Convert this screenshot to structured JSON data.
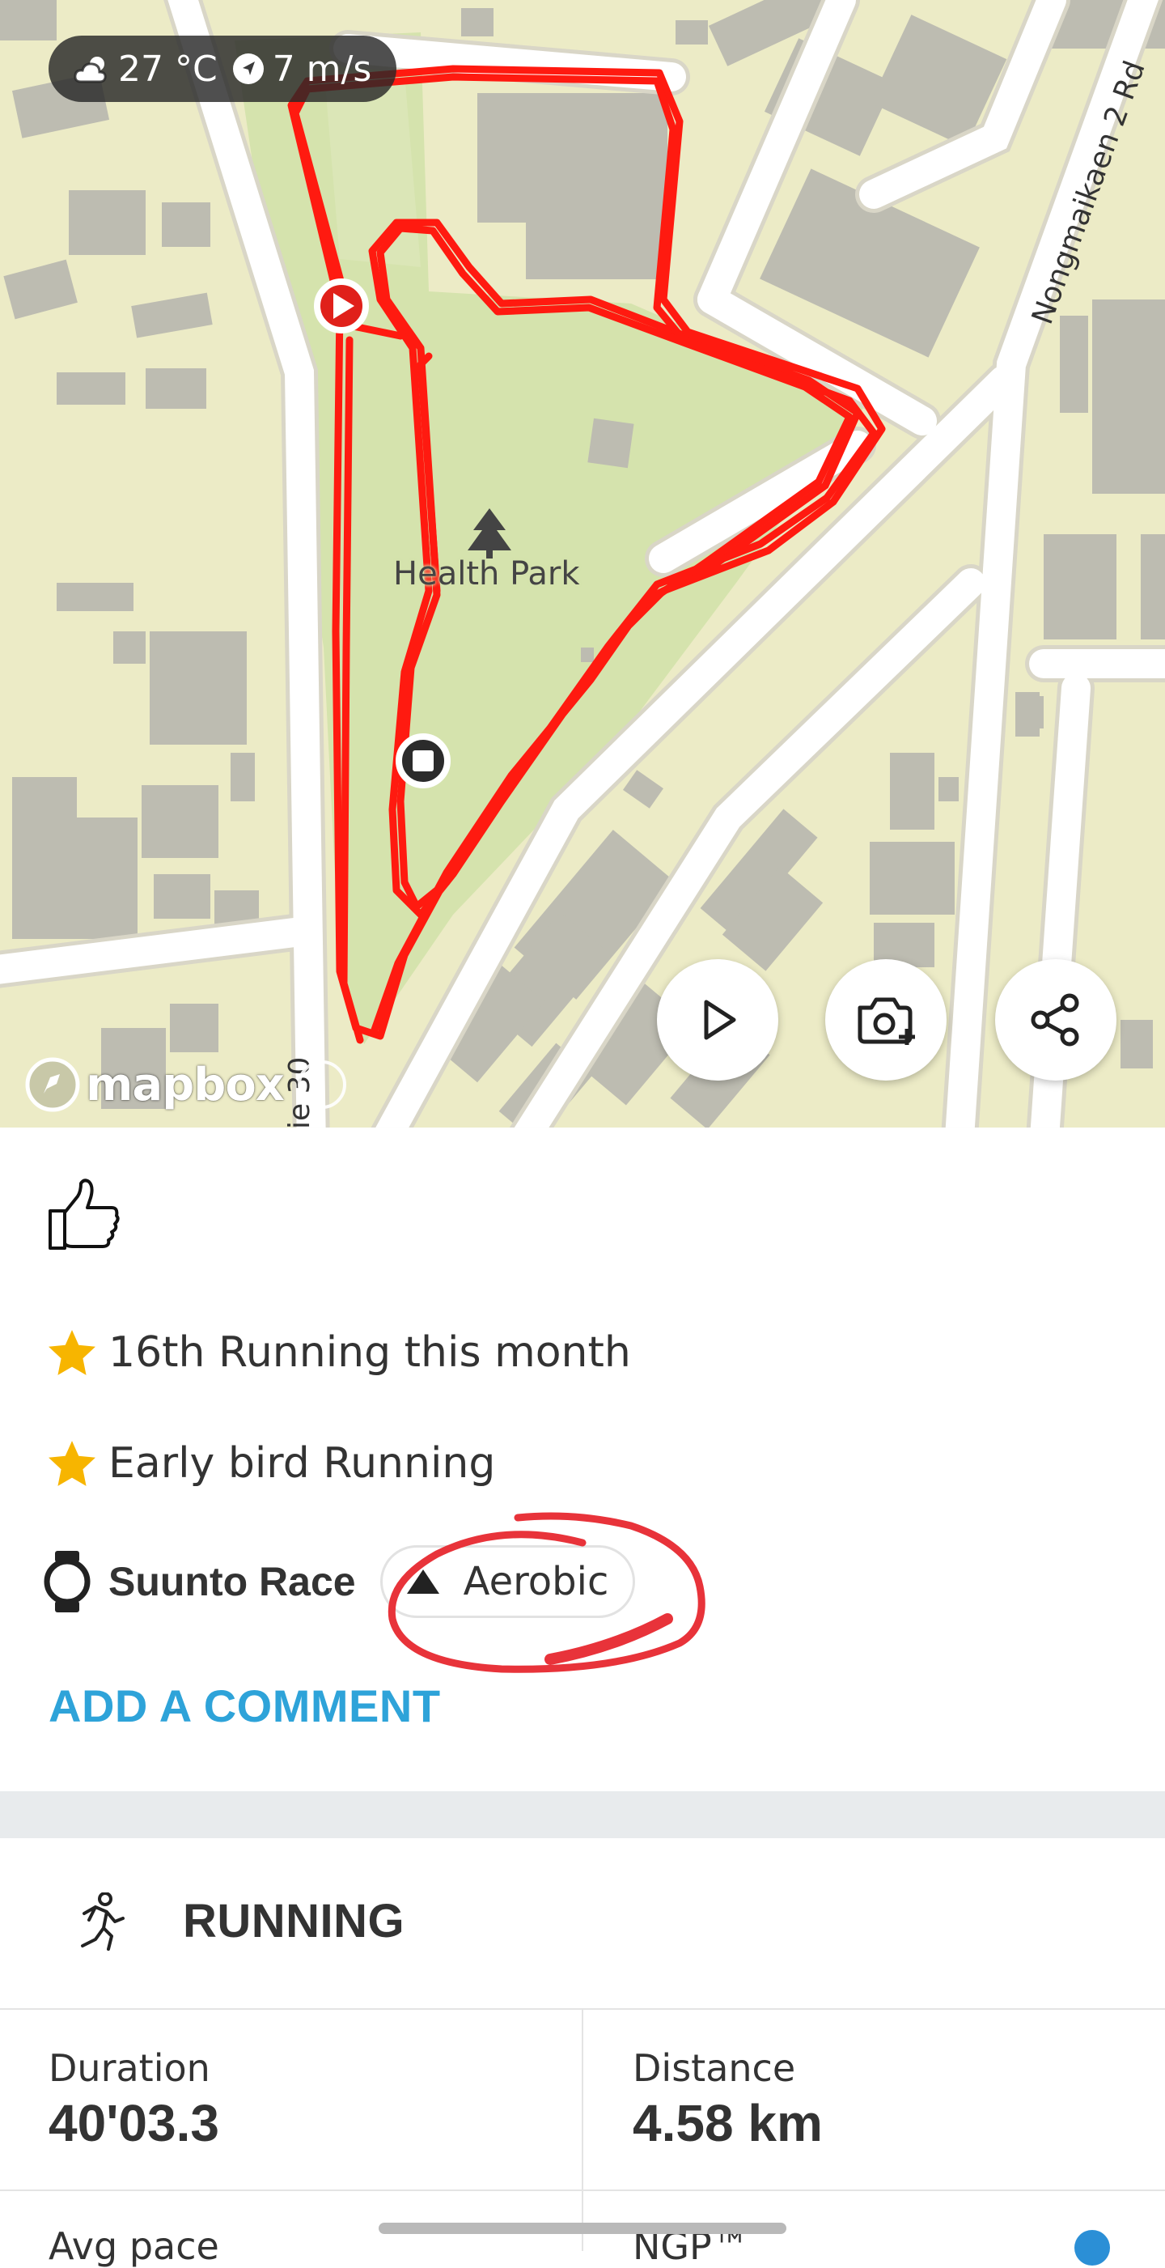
{
  "map": {
    "weather": {
      "temperature": "27 °C",
      "wind": "7 m/s",
      "weather_icon": "cloud-sun-icon",
      "wind_icon": "navigation-arrow-icon"
    },
    "park_name": "Health Park",
    "road_labels": {
      "right": "Nongmaikaen 2 Rd",
      "bottom": "ie 30"
    },
    "attribution": "mapbox",
    "route_color": "#ff0000",
    "buttons": {
      "play": "play-icon",
      "add_photo": "camera-plus-icon",
      "share": "share-icon"
    }
  },
  "feed": {
    "like_icon": "thumbs-up-icon",
    "achievements": [
      {
        "icon": "star-icon",
        "text": "16th Running this month"
      },
      {
        "icon": "star-icon",
        "text": "Early bird Running"
      }
    ],
    "device": "Suunto Race",
    "tag": "Aerobic",
    "add_comment": "ADD A COMMENT",
    "accent_color": "#2ea3d9",
    "annotation_color": "#e8333a"
  },
  "activity": {
    "icon": "running-icon",
    "title": "RUNNING",
    "stats": [
      {
        "label": "Duration",
        "value": "40'03.3"
      },
      {
        "label": "Distance",
        "value": "4.58 km"
      }
    ],
    "next_row": {
      "left_label": "Avg pace",
      "right_label": "NGP™"
    }
  }
}
